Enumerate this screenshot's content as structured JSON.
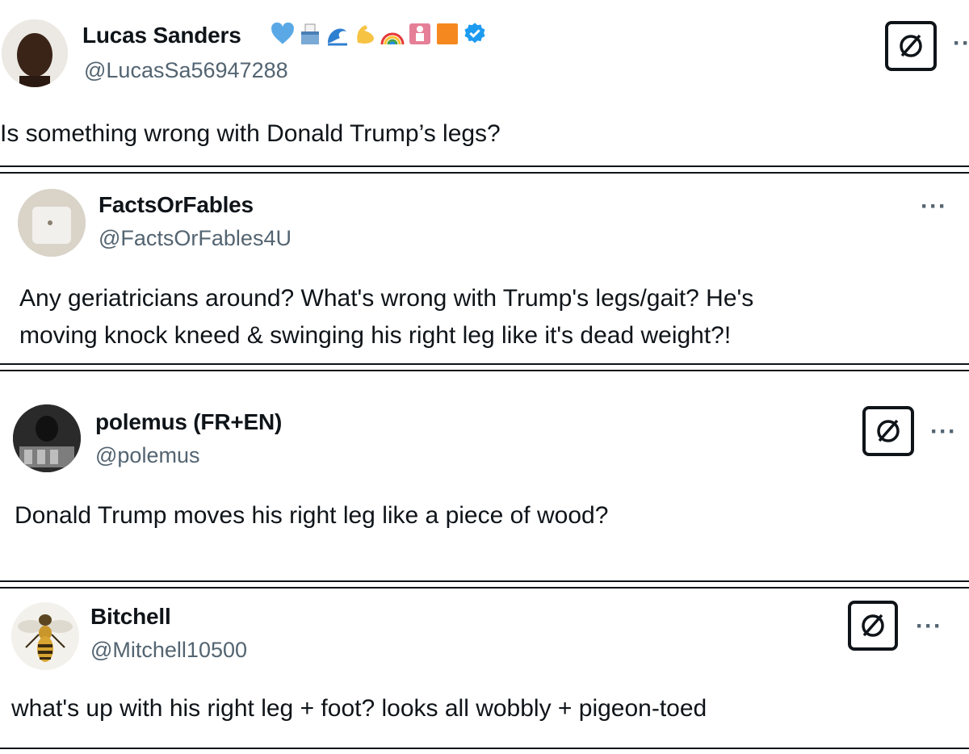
{
  "tweets": [
    {
      "display_name": "Lucas Sanders",
      "handle": "@LucasSa56947288",
      "text": "Is something wrong with Donald Trump’s legs?",
      "verified": true,
      "badge_icons": [
        "blue-heart-icon",
        "ballot-box-icon",
        "wave-icon",
        "flexed-biceps-icon",
        "rainbow-icon",
        "baby-symbol-icon",
        "orange-square-icon"
      ]
    },
    {
      "display_name": "FactsOrFables",
      "handle": "@FactsOrFables4U",
      "text_lines": [
        "Any geriatricians around? What's wrong with Trump's legs/gait? He's",
        "moving knock kneed & swinging his right leg like it's dead weight?!"
      ]
    },
    {
      "display_name": "polemus (FR+EN)",
      "handle": "@polemus",
      "text": "Donald Trump moves his right leg like a piece of wood?"
    },
    {
      "display_name": "Bitchell",
      "handle": "@Mitchell10500",
      "text": "what's up with his right leg + foot? looks all wobbly + pigeon-toed"
    }
  ],
  "more_label": "···",
  "colors": {
    "text": "#0f1419",
    "secondary": "#536471",
    "verified": "#1d9bf0"
  }
}
